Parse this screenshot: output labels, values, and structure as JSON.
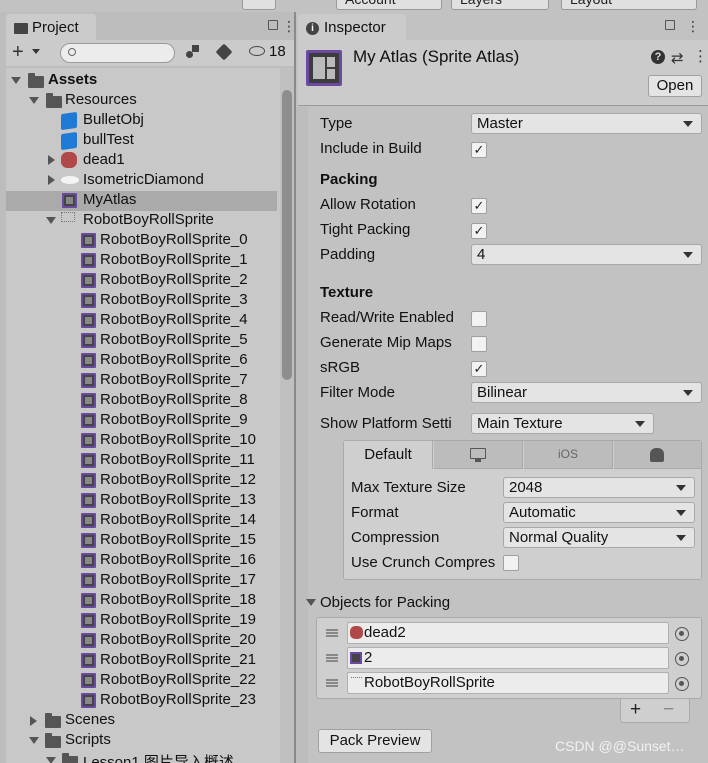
{
  "topbar": {
    "account": "Account",
    "layers": "Layers",
    "layout": "Layout"
  },
  "project": {
    "tab_label": "Project",
    "search_placeholder": "",
    "hidden_count": "18",
    "tree": {
      "assets": "Assets",
      "resources": "Resources",
      "bullet_obj": "BulletObj",
      "bull_test": "bullTest",
      "dead1": "dead1",
      "isometric": "IsometricDiamond",
      "my_atlas": "MyAtlas",
      "robot_parent": "RobotBoyRollSprite",
      "sprites": [
        "RobotBoyRollSprite_0",
        "RobotBoyRollSprite_1",
        "RobotBoyRollSprite_2",
        "RobotBoyRollSprite_3",
        "RobotBoyRollSprite_4",
        "RobotBoyRollSprite_5",
        "RobotBoyRollSprite_6",
        "RobotBoyRollSprite_7",
        "RobotBoyRollSprite_8",
        "RobotBoyRollSprite_9",
        "RobotBoyRollSprite_10",
        "RobotBoyRollSprite_11",
        "RobotBoyRollSprite_12",
        "RobotBoyRollSprite_13",
        "RobotBoyRollSprite_14",
        "RobotBoyRollSprite_15",
        "RobotBoyRollSprite_16",
        "RobotBoyRollSprite_17",
        "RobotBoyRollSprite_18",
        "RobotBoyRollSprite_19",
        "RobotBoyRollSprite_20",
        "RobotBoyRollSprite_21",
        "RobotBoyRollSprite_22",
        "RobotBoyRollSprite_23"
      ],
      "scenes": "Scenes",
      "scripts": "Scripts",
      "lesson": "Lesson1 图片导入概述"
    }
  },
  "inspector": {
    "tab_label": "Inspector",
    "title": "My Atlas (Sprite Atlas)",
    "open_button": "Open",
    "type_label": "Type",
    "type_value": "Master",
    "include_label": "Include in Build",
    "packing_header": "Packing",
    "allow_rotation": "Allow Rotation",
    "tight_packing": "Tight Packing",
    "padding_label": "Padding",
    "padding_value": "4",
    "texture_header": "Texture",
    "rw_enabled": "Read/Write Enabled",
    "gen_mip": "Generate Mip Maps",
    "srgb": "sRGB",
    "filter_label": "Filter Mode",
    "filter_value": "Bilinear",
    "platform_label": "Show Platform Setti",
    "platform_value": "Main Texture",
    "platform_tabs": {
      "default": "Default",
      "ios": "iOS"
    },
    "max_tex_label": "Max Texture Size",
    "max_tex_value": "2048",
    "format_label": "Format",
    "format_value": "Automatic",
    "compression_label": "Compression",
    "compression_value": "Normal Quality",
    "crunch_label": "Use Crunch Compres",
    "objects_header": "Objects for Packing",
    "objects": [
      "dead2",
      "2",
      "RobotBoyRollSprite"
    ],
    "add_label": "+",
    "remove_label": "−",
    "pack_preview": "Pack Preview",
    "watermark": "CSDN @@Sunset…"
  },
  "colors": {
    "selection": "#aaaaaa",
    "sprite_border": "#6a4aa0",
    "cube": "#1f7ad6"
  }
}
